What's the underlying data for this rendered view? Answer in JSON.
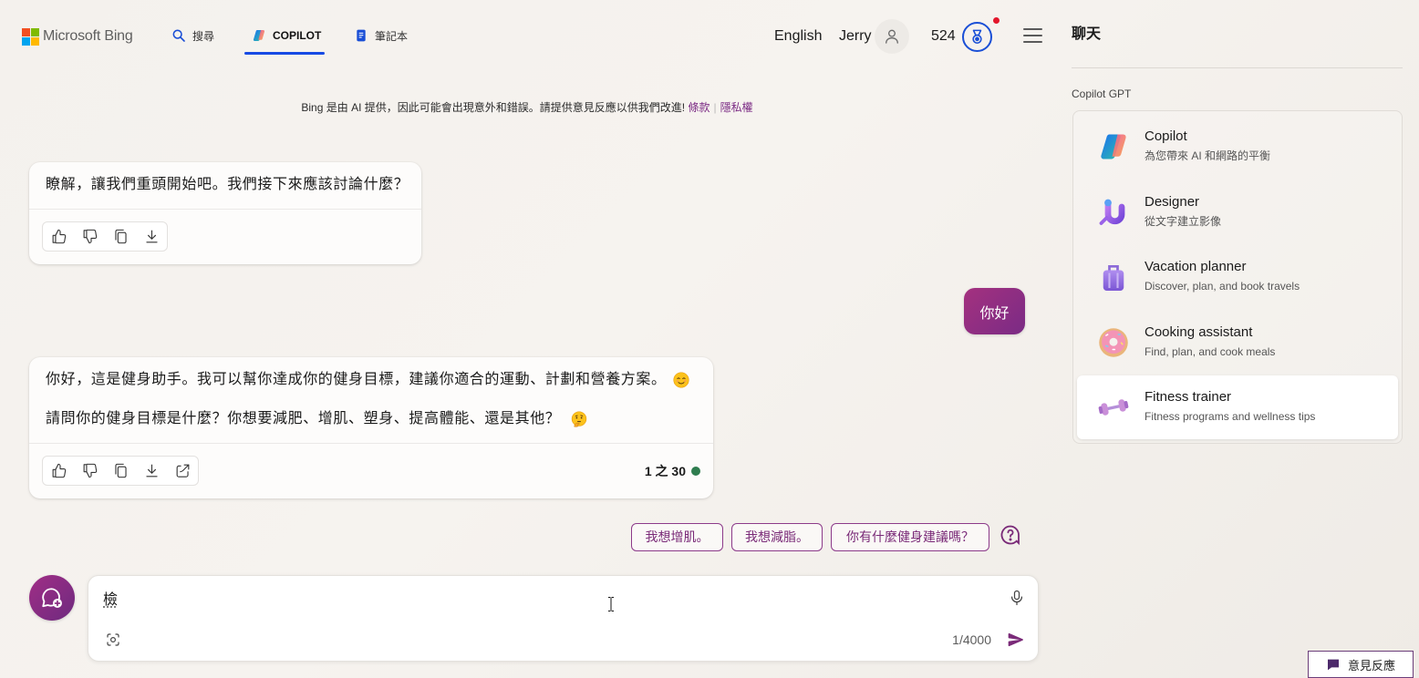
{
  "header": {
    "brand": "Microsoft Bing",
    "nav": [
      {
        "label": "搜尋",
        "icon": "search-icon",
        "active": false
      },
      {
        "label": "COPILOT",
        "icon": "copilot-icon",
        "active": true
      },
      {
        "label": "筆記本",
        "icon": "notebook-icon",
        "active": false
      }
    ],
    "language": "English",
    "user_name": "Jerry",
    "reward_points": "524",
    "notification_dot": true
  },
  "disclaimer": {
    "text": "Bing 是由 AI 提供，因此可能會出現意外和錯誤。請提供意見反應以供我們改進!",
    "terms_link": "條款",
    "separator": "|",
    "privacy_link": "隱私權"
  },
  "conversation": {
    "messages": [
      {
        "role": "assistant",
        "paragraphs": [
          {
            "text": "瞭解，讓我們重頭開始吧。我們接下來應該討論什麼？"
          }
        ],
        "actions": [
          "thumbs-up-icon",
          "thumbs-down-icon",
          "copy-icon",
          "download-icon"
        ]
      },
      {
        "role": "user",
        "text": "你好"
      },
      {
        "role": "assistant",
        "paragraphs": [
          {
            "text": "你好，這是健身助手。我可以幫你達成你的健身目標，建議你適合的運動、計劃和營養方案。",
            "emoji": "smiling-face-emoji"
          },
          {
            "text": "請問你的健身目標是什麼？你想要減肥、增肌、塑身、提高體能、還是其他？",
            "emoji": "thinking-face-emoji"
          }
        ],
        "actions": [
          "thumbs-up-icon",
          "thumbs-down-icon",
          "copy-icon",
          "download-icon",
          "share-icon"
        ],
        "turn_counter": "1 之 30"
      }
    ],
    "suggestions": [
      "我想增肌。",
      "我想減脂。",
      "你有什麼健身建議嗎？"
    ]
  },
  "composer": {
    "value": "檢",
    "char_count": "1/4000"
  },
  "sidebar": {
    "title": "聊天",
    "section_label": "Copilot GPT",
    "gpts": [
      {
        "name": "Copilot",
        "description": "為您帶來 AI 和網路的平衡",
        "icon": "copilot-gpt-icon",
        "selected": false
      },
      {
        "name": "Designer",
        "description": "從文字建立影像",
        "icon": "designer-gpt-icon",
        "selected": false
      },
      {
        "name": "Vacation planner",
        "description": "Discover, plan, and book travels",
        "icon": "suitcase-icon",
        "selected": false
      },
      {
        "name": "Cooking assistant",
        "description": "Find, plan, and cook meals",
        "icon": "donut-icon",
        "selected": false
      },
      {
        "name": "Fitness trainer",
        "description": "Fitness programs and wellness tips",
        "icon": "dumbbell-icon",
        "selected": true
      }
    ]
  },
  "feedback": {
    "label": "意見反應"
  },
  "colors": {
    "accent": "#7b2a84",
    "nav_active": "#174ae4",
    "notification": "#e3162b",
    "status_online": "#2f7d4f",
    "user_bubble": "#a4317f"
  }
}
